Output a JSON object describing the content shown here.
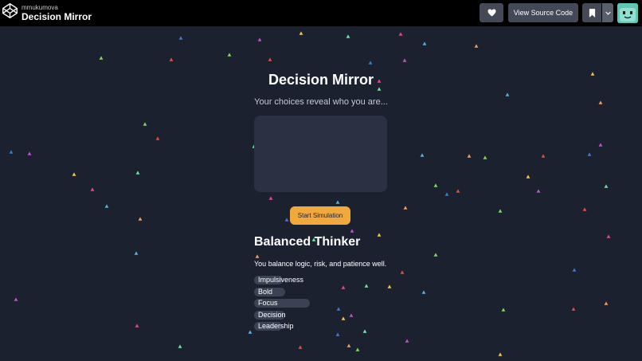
{
  "topbar": {
    "owner": "mmukumova",
    "pen_title": "Decision Mirror",
    "view_source_label": "View Source Code"
  },
  "app": {
    "title": "Decision Mirror",
    "tagline": "Your choices reveal who you are...",
    "start_button": "Start Simulation",
    "result_title": "Balanced Thinker",
    "result_description": "You balance logic, risk, and patience well.",
    "traits": [
      {
        "label": "Impulsiveness",
        "level": 0.26
      },
      {
        "label": "Bold",
        "level": 0.28
      },
      {
        "label": "Focus",
        "level": 0.5
      },
      {
        "label": "Decision",
        "level": 0.28
      },
      {
        "label": "Leadership",
        "level": 0.25
      }
    ]
  },
  "colors": {
    "background": "#1c2130",
    "accent": "#f2a93b",
    "panel": "#2a3142",
    "confetti": [
      "#7ed957",
      "#e74c3c",
      "#3a7bd5",
      "#c84bd8",
      "#f4c542",
      "#64e7a1",
      "#e84393",
      "#5dade2",
      "#f39c5a"
    ]
  }
}
